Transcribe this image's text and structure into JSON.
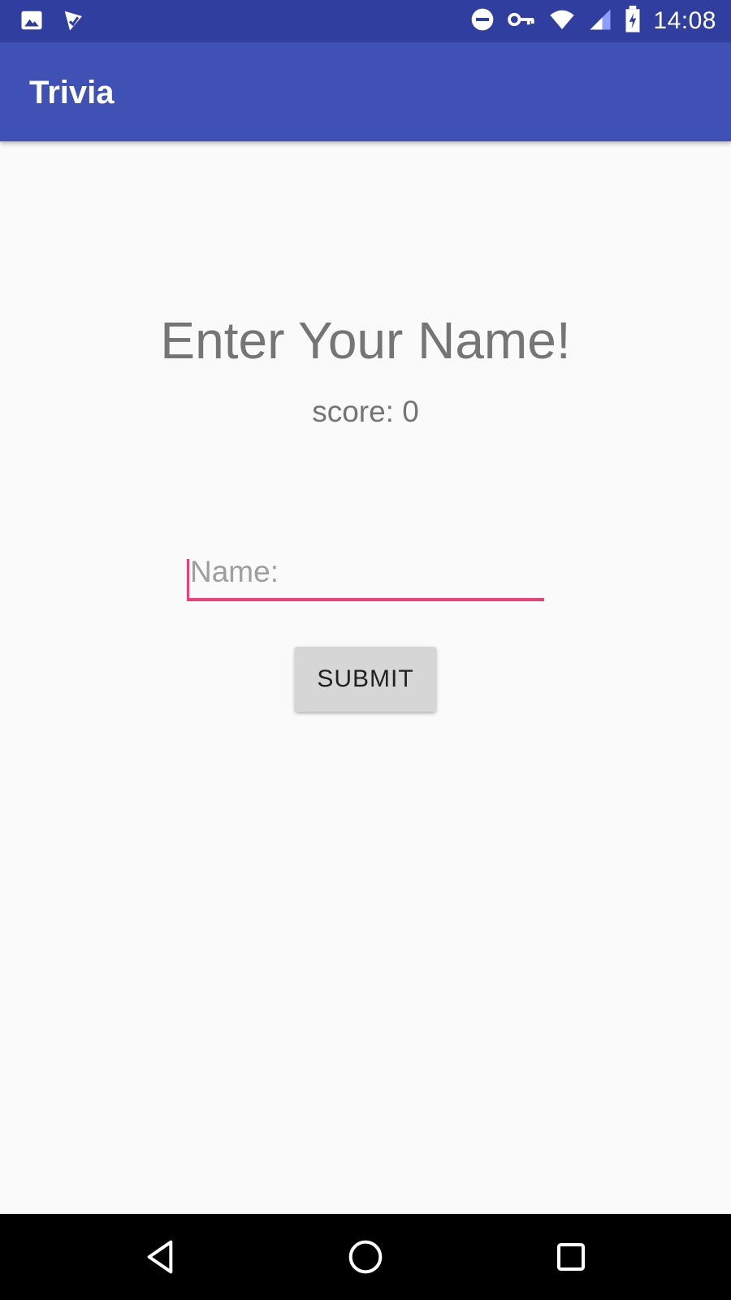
{
  "status_bar": {
    "time": "14:08",
    "left_icons": [
      "image-notification-icon",
      "play-store-icon"
    ],
    "right_icons": [
      "do-not-disturb-icon",
      "vpn-key-icon",
      "wifi-icon",
      "cell-signal-icon",
      "battery-charging-icon"
    ]
  },
  "app_bar": {
    "title": "Trivia"
  },
  "main": {
    "headline": "Enter Your Name!",
    "score_text": "score: 0",
    "name_input": {
      "placeholder": "Name:",
      "value": ""
    },
    "submit_label": "SUBMIT"
  },
  "nav_bar": {
    "buttons": [
      "back-icon",
      "home-icon",
      "recents-icon"
    ]
  },
  "colors": {
    "status_bar": "#303F9F",
    "app_bar": "#3F51B5",
    "accent": "#EC407A",
    "background": "#FAFAFA"
  }
}
